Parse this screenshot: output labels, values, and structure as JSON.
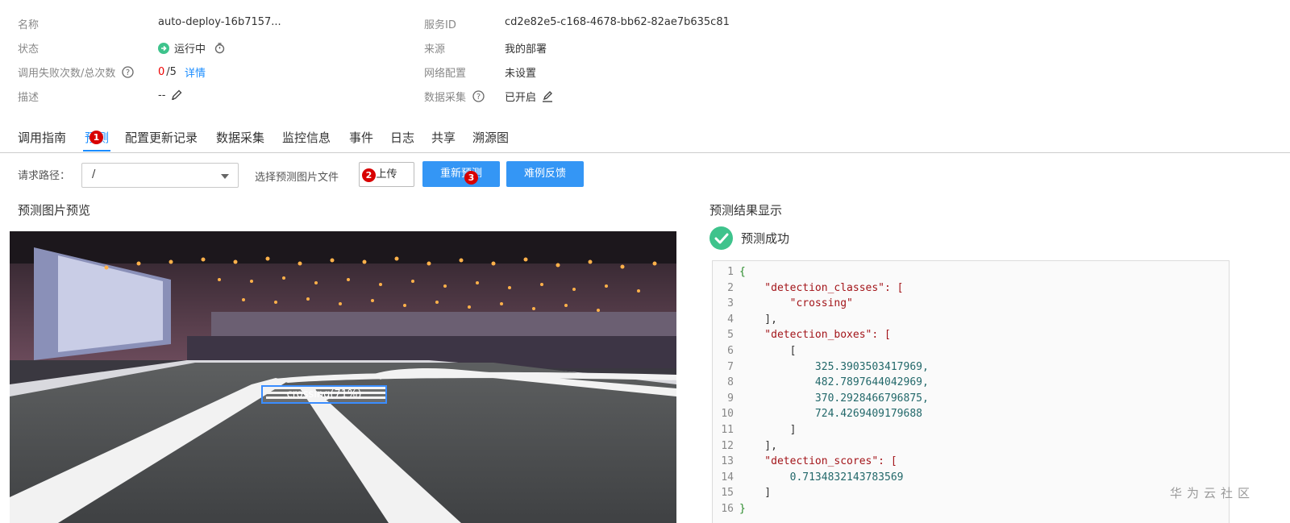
{
  "info": {
    "name_label": "名称",
    "name_value": "auto-deploy-16b7157...",
    "status_label": "状态",
    "status_value": "运行中",
    "fail_label": "调用失败次数/总次数",
    "fail_count": "0",
    "total_count": "/5",
    "detail_link": "详情",
    "desc_label": "描述",
    "desc_value": "--",
    "service_id_label": "服务ID",
    "service_id_value": "cd2e82e5-c168-4678-bb62-82ae7b635c81",
    "source_label": "来源",
    "source_value": "我的部署",
    "network_label": "网络配置",
    "network_value": "未设置",
    "collect_label": "数据采集",
    "collect_value": "已开启"
  },
  "tabs": [
    {
      "label": "调用指南",
      "active": false
    },
    {
      "label": "预测",
      "active": true
    },
    {
      "label": "配置更新记录",
      "active": false
    },
    {
      "label": "数据采集",
      "active": false
    },
    {
      "label": "监控信息",
      "active": false
    },
    {
      "label": "事件",
      "active": false
    },
    {
      "label": "日志",
      "active": false
    },
    {
      "label": "共享",
      "active": false
    },
    {
      "label": "溯源图",
      "active": false
    }
  ],
  "badges": [
    "1",
    "2",
    "3"
  ],
  "toolbar": {
    "request_path_label": "请求路径：",
    "request_path_value": "/",
    "file_label": "选择预测图片文件",
    "upload_label": "上传",
    "repredict_label": "重新预测",
    "feedback_label": "难例反馈"
  },
  "preview": {
    "title": "预测图片预览",
    "detection_label": "crossing(71%)"
  },
  "result": {
    "title": "预测结果显示",
    "status": "预测成功",
    "json_lines": [
      {
        "n": "1",
        "t": "{"
      },
      {
        "n": "2",
        "t": "    \"detection_classes\": ["
      },
      {
        "n": "3",
        "t": "        \"crossing\""
      },
      {
        "n": "4",
        "t": "    ],"
      },
      {
        "n": "5",
        "t": "    \"detection_boxes\": ["
      },
      {
        "n": "6",
        "t": "        ["
      },
      {
        "n": "7",
        "t": "            325.3903503417969,"
      },
      {
        "n": "8",
        "t": "            482.7897644042969,"
      },
      {
        "n": "9",
        "t": "            370.2928466796875,"
      },
      {
        "n": "10",
        "t": "            724.4269409179688"
      },
      {
        "n": "11",
        "t": "        ]"
      },
      {
        "n": "12",
        "t": "    ],"
      },
      {
        "n": "13",
        "t": "    \"detection_scores\": ["
      },
      {
        "n": "14",
        "t": "        0.7134832143783569"
      },
      {
        "n": "15",
        "t": "    ]"
      },
      {
        "n": "16",
        "t": "}"
      }
    ]
  },
  "watermark": "华为云社区",
  "colors": {
    "accent": "#1a8cff",
    "button": "#3496f5",
    "success": "#3ec38c",
    "error": "#e00000",
    "badge": "#d80000"
  }
}
